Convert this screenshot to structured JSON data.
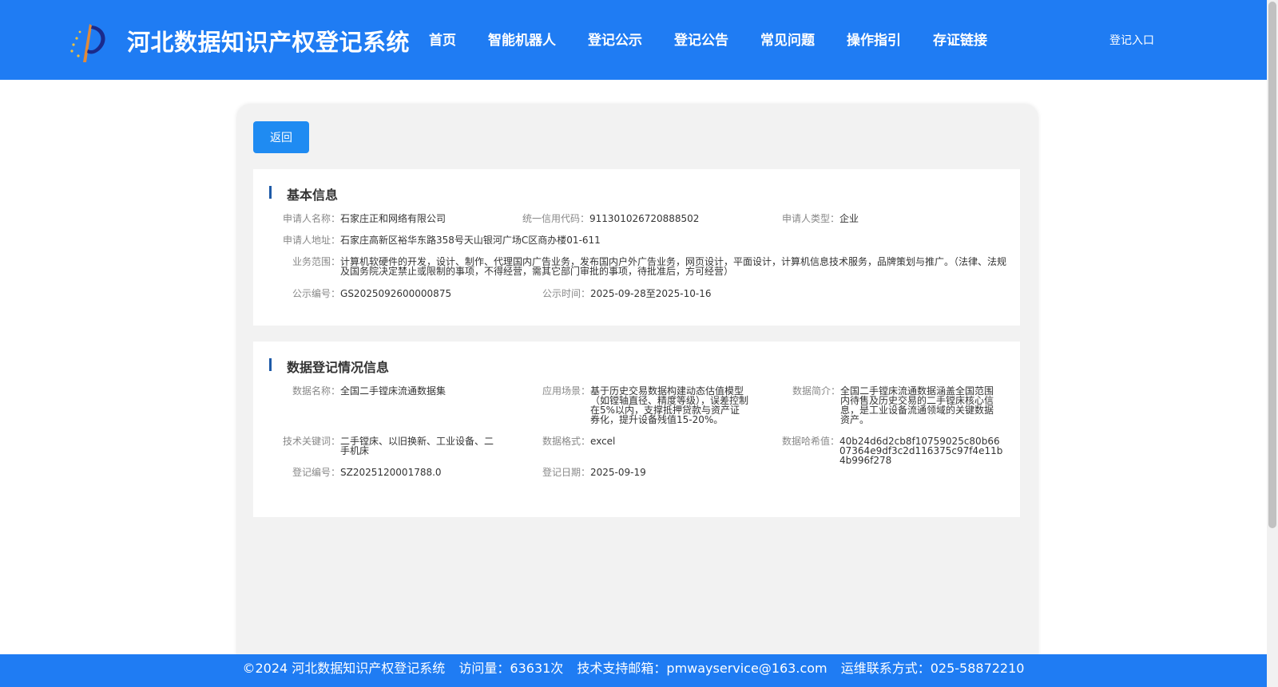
{
  "header": {
    "title": "河北数据知识产权登记系统",
    "nav": [
      "首页",
      "智能机器人",
      "登记公示",
      "登记公告",
      "常见问题",
      "操作指引",
      "存证链接"
    ],
    "login": "登记入口"
  },
  "back_label": "返回",
  "basic_info": {
    "title": "基本信息",
    "fields": [
      {
        "label": "申请人名称：",
        "value": "石家庄正和网络有限公司"
      },
      {
        "label": "统一信用代码：",
        "value": "911301026720888502"
      },
      {
        "label": "申请人类型：",
        "value": "企业"
      },
      {
        "label": "申请人地址：",
        "value": "石家庄高新区裕华东路358号天山银河广场C区商办楼01-611"
      },
      {
        "label": "业务范围：",
        "value": "计算机软硬件的开发，设计、制作、代理国内广告业务，发布国内户外广告业务，网页设计，平面设计，计算机信息技术服务，品牌策划与推广。（法律、法规及国务院决定禁止或限制的事项，不得经营，需其它部门审批的事项，待批准后，方可经营）"
      },
      {
        "label": "公示编号：",
        "value": "GS2025092600000875"
      },
      {
        "label": "公示时间：",
        "value": "2025-09-28至2025-10-16"
      }
    ]
  },
  "data_info": {
    "title": "数据登记情况信息",
    "fields": [
      {
        "label": "数据名称：",
        "value": "全国二手镗床流通数据集"
      },
      {
        "label": "应用场景：",
        "value": "基于历史交易数据构建动态估值模型（如镗轴直径、精度等级），误差控制在5%以内，支撑抵押贷款与资产证券化，提升设备残值15-20%。"
      },
      {
        "label": "数据简介：",
        "value": "全国二手镗床流通数据涵盖全国范围内待售及历史交易的二手镗床核心信息，是工业设备流通领域的关键数据资产。"
      },
      {
        "label": "技术关键词：",
        "value": "二手镗床、以旧换新、工业设备、二手机床"
      },
      {
        "label": "数据格式：",
        "value": "excel"
      },
      {
        "label": "数据哈希值：",
        "value": "40b24d6d2cb8f10759025c80b6607364e9df3c2d116375c97f4e11b4b996f278"
      },
      {
        "label": "登记编号：",
        "value": "SZ2025120001788.0"
      },
      {
        "label": "登记日期：",
        "value": "2025-09-19"
      }
    ]
  },
  "footer": {
    "copyright": "©2024 河北数据知识产权登记系统",
    "visits": "访问量：63631次",
    "email": "技术支持邮箱：pmwayservice@163.com",
    "phone": "运维联系方式：025-58872210"
  },
  "colors": {
    "brand_blue": "#1f7cf3",
    "button_blue": "#1f8bf2",
    "section_bar": "#1e5aa8"
  }
}
